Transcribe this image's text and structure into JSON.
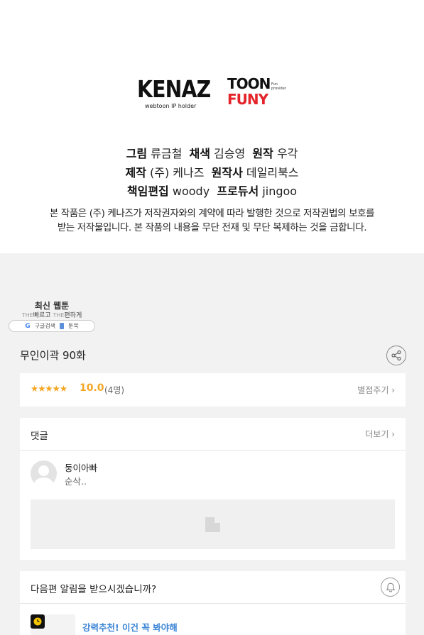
{
  "credits": {
    "kenaz_logo": {
      "name": "KENAZ",
      "sub": "webtoon IP holder"
    },
    "toon_logo": {
      "row1": "TOON",
      "row2": "FUNY",
      "tagline": "Fun provider"
    },
    "line1": {
      "l1": "그림",
      "v1": "류금철",
      "l2": "채색",
      "v2": "김승영",
      "l3": "원작",
      "v3": "우각"
    },
    "line2": {
      "l1": "제작",
      "v1": "(주) 케나즈",
      "l2": "원작사",
      "v2": "데일리북스"
    },
    "line3": {
      "l1": "책임편집",
      "v1": "woody",
      "l2": "프로듀서",
      "v2": "jingoo"
    },
    "copyright_1": "본 작품은 (주) 케나즈가 저작권자와의 계약에 따라 발행한 것으로 저작권법의 보호를",
    "copyright_2": "받는 저작물입니다. 본 작품의 내용을 무단 전재 및 무단 복제하는 것을 금합니다."
  },
  "badge": {
    "title": "최신 웹툰",
    "sub_the1": "THE",
    "sub_word1": "빠르고",
    "sub_the2": "THE",
    "sub_word2": "편하게",
    "google_label": "구글검색",
    "toonbook_label": "툰북"
  },
  "episode": {
    "title": "무인이곽 90화"
  },
  "rating": {
    "stars": "★★★★★",
    "score": "10.0",
    "count": "(4명)",
    "link": "별점주기 ›"
  },
  "comments": {
    "header": "댓글",
    "more": "더보기 ›",
    "items": [
      {
        "name": "둥이아빠",
        "text": "순삭.."
      }
    ]
  },
  "notify": {
    "question": "다음편 알림을 받으시겠습니까?",
    "recommend_title": "강력추천! 이건 꼭 봐야해"
  },
  "colors": {
    "accent_star": "#f5a623",
    "link_blue": "#3a84d6",
    "background": "#f2f2f2"
  },
  "icons": [
    "share-icon",
    "bell-icon",
    "clock-icon",
    "avatar-placeholder",
    "image-placeholder-icon"
  ]
}
